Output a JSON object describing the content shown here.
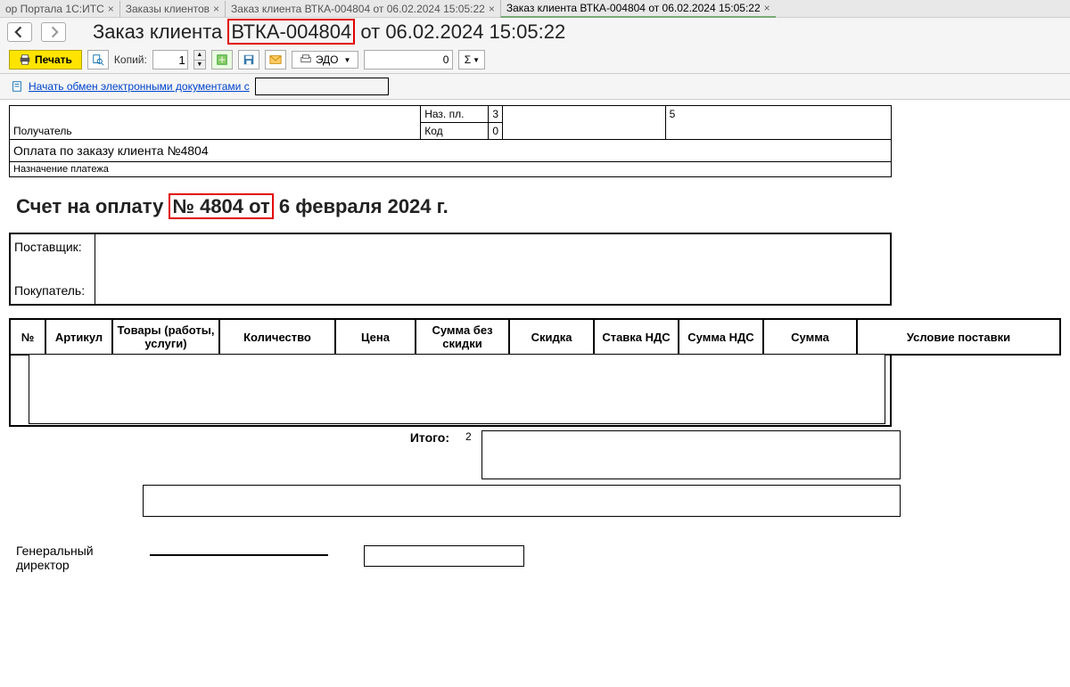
{
  "tabs": [
    {
      "label": "ор Портала 1С:ИТС"
    },
    {
      "label": "Заказы клиентов"
    },
    {
      "label": "Заказ клиента ВТКА-004804 от 06.02.2024 15:05:22"
    },
    {
      "label": "Заказ клиента ВТКА-004804 от 06.02.2024 15:05:22",
      "active": true
    }
  ],
  "header": {
    "title_prefix": "Заказ клиента ",
    "doc_number": "ВТКА-004804",
    "title_suffix": " от 06.02.2024 15:05:22"
  },
  "toolbar": {
    "print_label": "Печать",
    "copies_label": "Копий:",
    "copies_value": "1",
    "edo_label": "ЭДО",
    "value_box": "0",
    "sigma": "Σ"
  },
  "link": {
    "text": "Начать обмен электронными документами с"
  },
  "topblock": {
    "recipient_label": "Получатель",
    "naz_pl_label": "Наз. пл.",
    "kod_label": "Код",
    "naz_pl_value": "5",
    "col3_top": "3",
    "col3_bot": "0"
  },
  "middle": {
    "payment_text": "Оплата по заказу клиента №4804",
    "purpose_label": "Назначение платежа"
  },
  "invoice_title": {
    "prefix": "Счет на оплату ",
    "num_hl": "№ 4804 от",
    "suffix": " 6 февраля 2024 г."
  },
  "parties": {
    "supplier": "Поставщик:",
    "buyer": "Покупатель:"
  },
  "columns": {
    "num": "№",
    "sku": "Артикул",
    "goods": "Товары (работы, услуги)",
    "qty": "Количество",
    "price": "Цена",
    "sum_no_disc": "Сумма без скидки",
    "disc": "Скидка",
    "vat_rate": "Ставка НДС",
    "vat_sum": "Сумма НДС",
    "sum": "Сумма",
    "delivery": "Условие поставки"
  },
  "totals": {
    "label": "Итого:",
    "value": "2"
  },
  "signature": {
    "gen_dir": "Генеральный директор"
  }
}
